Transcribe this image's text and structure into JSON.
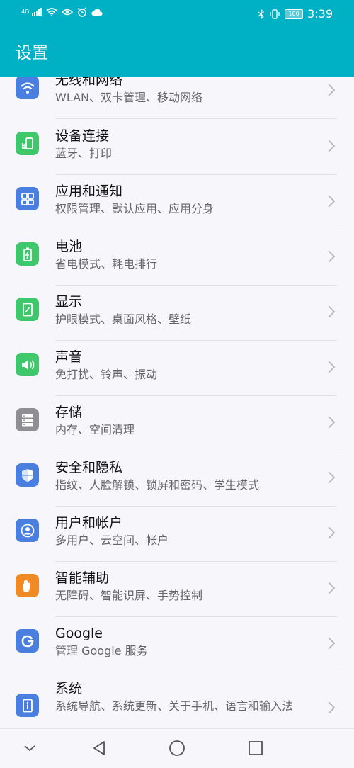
{
  "statusbar": {
    "network": "4G",
    "battery": "100",
    "time": "3:39"
  },
  "appbar": {
    "title": "设置"
  },
  "items": [
    {
      "title": "无线和网络",
      "subtitle": "WLAN、双卡管理、移动网络",
      "icon": "wifi-icon",
      "color": "#4a7fe0"
    },
    {
      "title": "设备连接",
      "subtitle": "蓝牙、打印",
      "icon": "device-connect-icon",
      "color": "#3fc76b"
    },
    {
      "title": "应用和通知",
      "subtitle": "权限管理、默认应用、应用分身",
      "icon": "apps-icon",
      "color": "#4a7fe0"
    },
    {
      "title": "电池",
      "subtitle": "省电模式、耗电排行",
      "icon": "battery-icon",
      "color": "#3fc76b"
    },
    {
      "title": "显示",
      "subtitle": "护眼模式、桌面风格、壁纸",
      "icon": "display-icon",
      "color": "#3fc76b"
    },
    {
      "title": "声音",
      "subtitle": "免打扰、铃声、振动",
      "icon": "sound-icon",
      "color": "#3fc76b"
    },
    {
      "title": "存储",
      "subtitle": "内存、空间清理",
      "icon": "storage-icon",
      "color": "#8e8e93"
    },
    {
      "title": "安全和隐私",
      "subtitle": "指纹、人脸解锁、锁屏和密码、学生模式",
      "icon": "shield-icon",
      "color": "#4a7fe0"
    },
    {
      "title": "用户和帐户",
      "subtitle": "多用户、云空间、帐户",
      "icon": "user-icon",
      "color": "#4a7fe0"
    },
    {
      "title": "智能辅助",
      "subtitle": "无障碍、智能识屏、手势控制",
      "icon": "hand-icon",
      "color": "#f08a24"
    },
    {
      "title": "Google",
      "subtitle": "管理 Google 服务",
      "icon": "google-icon",
      "color": "#4a7fe0"
    },
    {
      "title": "系统",
      "subtitle": "系统导航、系统更新、关于手机、语言和输入法",
      "icon": "system-info-icon",
      "color": "#4a7fe0"
    }
  ],
  "navbar": {
    "buttons": [
      "collapse-nav-button",
      "back-nav-button",
      "home-nav-button",
      "recents-nav-button"
    ]
  }
}
